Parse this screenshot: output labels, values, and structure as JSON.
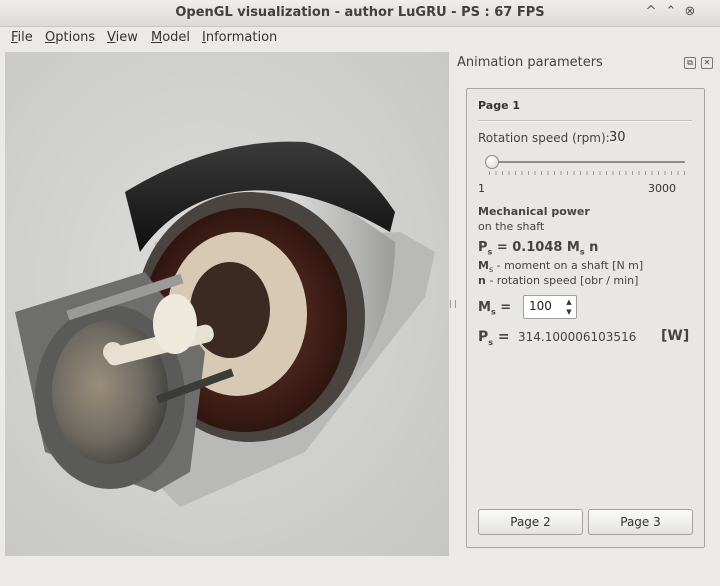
{
  "window": {
    "title": "OpenGL visualization - author LuGRU - PS : 67 FPS",
    "minimize": "^",
    "maximize": "⌃",
    "close": "⊗"
  },
  "menu": [
    {
      "first": "F",
      "rest": "ile"
    },
    {
      "first": "O",
      "rest": "ptions"
    },
    {
      "first": "V",
      "rest": "iew"
    },
    {
      "first": "M",
      "rest": "odel"
    },
    {
      "first": "I",
      "rest": "nformation"
    }
  ],
  "dock": {
    "title": "Animation parameters",
    "float_icon": "⧉",
    "close_icon": "✕"
  },
  "panel": {
    "page_title": "Page 1",
    "rotation_label": "Rotation speed (rpm):",
    "rotation_value": "30",
    "slider_min": "1",
    "slider_max": "3000",
    "slider_value": 30,
    "slider_range": [
      1,
      3000
    ],
    "mech_title": "Mechanical power",
    "mech_sub": "on the shaft",
    "formula_a": "P",
    "formula_a_sub": "s",
    "formula_b": " = 0.1048 M",
    "formula_b_sub": "s",
    "formula_c": " n",
    "legend_ms_sym": "M",
    "legend_ms_sub": "s",
    "legend_ms_text": " - moment on a shaft [N m]",
    "legend_n_sym": "n",
    "legend_n_text": " - rotation speed [obr / min]",
    "ms_sym": "M",
    "ms_sub": "s",
    "ms_eq": " =",
    "ms_value": "100",
    "ps_sym": "P",
    "ps_sub": "s",
    "ps_eq": " =",
    "ps_value": "314.100006103516",
    "ps_unit": "[W]",
    "page2": "Page 2",
    "page3": "Page 3"
  }
}
